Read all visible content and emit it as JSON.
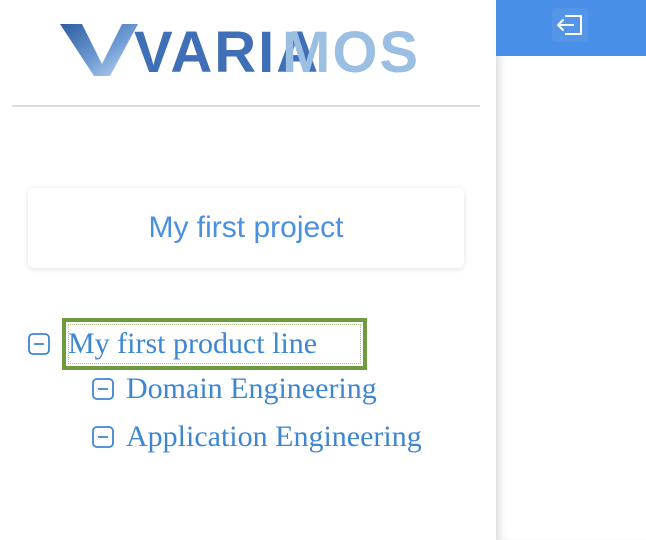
{
  "logo": {
    "text_var": "VARIA",
    "text_mos": "MOS",
    "colors": {
      "primary": "#3f6fb6",
      "light": "#9bbfe2"
    }
  },
  "topbar": {
    "color": "#4a8fe7",
    "exit_icon": "sign-out-icon"
  },
  "project": {
    "title": "My first project"
  },
  "tree": {
    "root": {
      "label": "My first product line",
      "icon": "minus-square-icon",
      "selected": true
    },
    "children": [
      {
        "label": "Domain Engineering",
        "icon": "minus-square-icon"
      },
      {
        "label": "Application Engineering",
        "icon": "minus-square-icon"
      }
    ]
  }
}
